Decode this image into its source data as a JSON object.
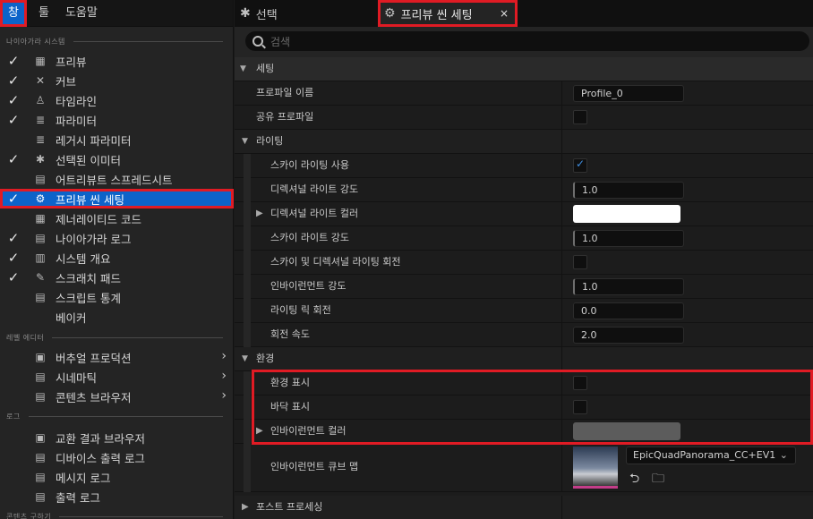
{
  "menubar": {
    "window": "창",
    "tools": "툴",
    "help": "도움말"
  },
  "left": {
    "section_niagara": "나이아가라 시스템",
    "items": [
      {
        "label": "프리뷰",
        "checked": "✓",
        "icon": "▦"
      },
      {
        "label": "커브",
        "checked": "✓",
        "icon": "✕"
      },
      {
        "label": "타임라인",
        "checked": "✓",
        "icon": "♙"
      },
      {
        "label": "파라미터",
        "checked": "✓",
        "icon": "≣"
      },
      {
        "label": "레거시 파라미터",
        "checked": "",
        "icon": "≣"
      },
      {
        "label": "선택된 이미터",
        "checked": "✓",
        "icon": "✱"
      },
      {
        "label": "어트리뷰트 스프레드시트",
        "checked": "",
        "icon": "▤"
      },
      {
        "label": "프리뷰 씬 세팅",
        "checked": "✓",
        "icon": "⚙"
      },
      {
        "label": "제너레이티드 코드",
        "checked": "",
        "icon": "▦"
      },
      {
        "label": "나이아가라 로그",
        "checked": "✓",
        "icon": "▤"
      },
      {
        "label": "시스템 개요",
        "checked": "✓",
        "icon": "▥"
      },
      {
        "label": "스크래치 패드",
        "checked": "✓",
        "icon": "✎"
      },
      {
        "label": "스크립트 통계",
        "checked": "",
        "icon": "▤"
      },
      {
        "label": "베이커",
        "checked": "",
        "icon": ""
      }
    ],
    "section_level_editor": "레벨 에디터",
    "level_items": [
      {
        "label": "버추얼 프로덕션",
        "icon": "▣",
        "arrow": "›"
      },
      {
        "label": "시네마틱",
        "icon": "▤",
        "arrow": "›"
      },
      {
        "label": "콘텐츠 브라우저",
        "icon": "▤",
        "arrow": "›"
      }
    ],
    "section_log": "로그",
    "log_items": [
      {
        "label": "교환 결과 브라우저",
        "icon": "▣"
      },
      {
        "label": "디바이스 출력 로그",
        "icon": "▤"
      },
      {
        "label": "메시지 로그",
        "icon": "▤"
      },
      {
        "label": "출력 로그",
        "icon": "▤"
      }
    ],
    "section_content": "콘텐츠 구하기"
  },
  "tabs": {
    "select": "선택",
    "preview": "프리뷰 씬 세팅",
    "close": "×"
  },
  "search": {
    "placeholder": "검색"
  },
  "props": {
    "settings": "세팅",
    "profile_name": "프로파일 이름",
    "profile_value": "Profile_0",
    "shared_profile": "공유 프로파일",
    "lighting": "라이팅",
    "sky_lighting": "스카이 라이팅 사용",
    "dir_light_intensity": "디렉셔널 라이트 강도",
    "dir_light_intensity_value": "1.0",
    "dir_light_color": "디렉셔널 라이트 컬러",
    "sky_light_intensity": "스카이 라이트 강도",
    "sky_light_intensity_value": "1.0",
    "sky_dir_rotation": "스카이 및 디렉셔널 라이팅 회전",
    "env_intensity": "인바이런먼트 강도",
    "env_intensity_value": "1.0",
    "lighting_rig_rotation": "라이팅 릭 회전",
    "lighting_rig_rotation_value": "0.0",
    "rotation_speed": "회전 속도",
    "rotation_speed_value": "2.0",
    "environment": "환경",
    "show_env": "환경 표시",
    "show_floor": "바닥 표시",
    "env_color": "인바이런먼트 컬러",
    "env_cubemap": "인바이런먼트 큐브 맵",
    "cubemap_value": "EpicQuadPanorama_CC+EV1",
    "post_processing": "포스트 프로세싱"
  },
  "colors": {
    "accent": "#0d63c9",
    "highlight": "#e01b24",
    "dir_light_color": "#ffffff",
    "env_color": "#5c5c5c"
  }
}
